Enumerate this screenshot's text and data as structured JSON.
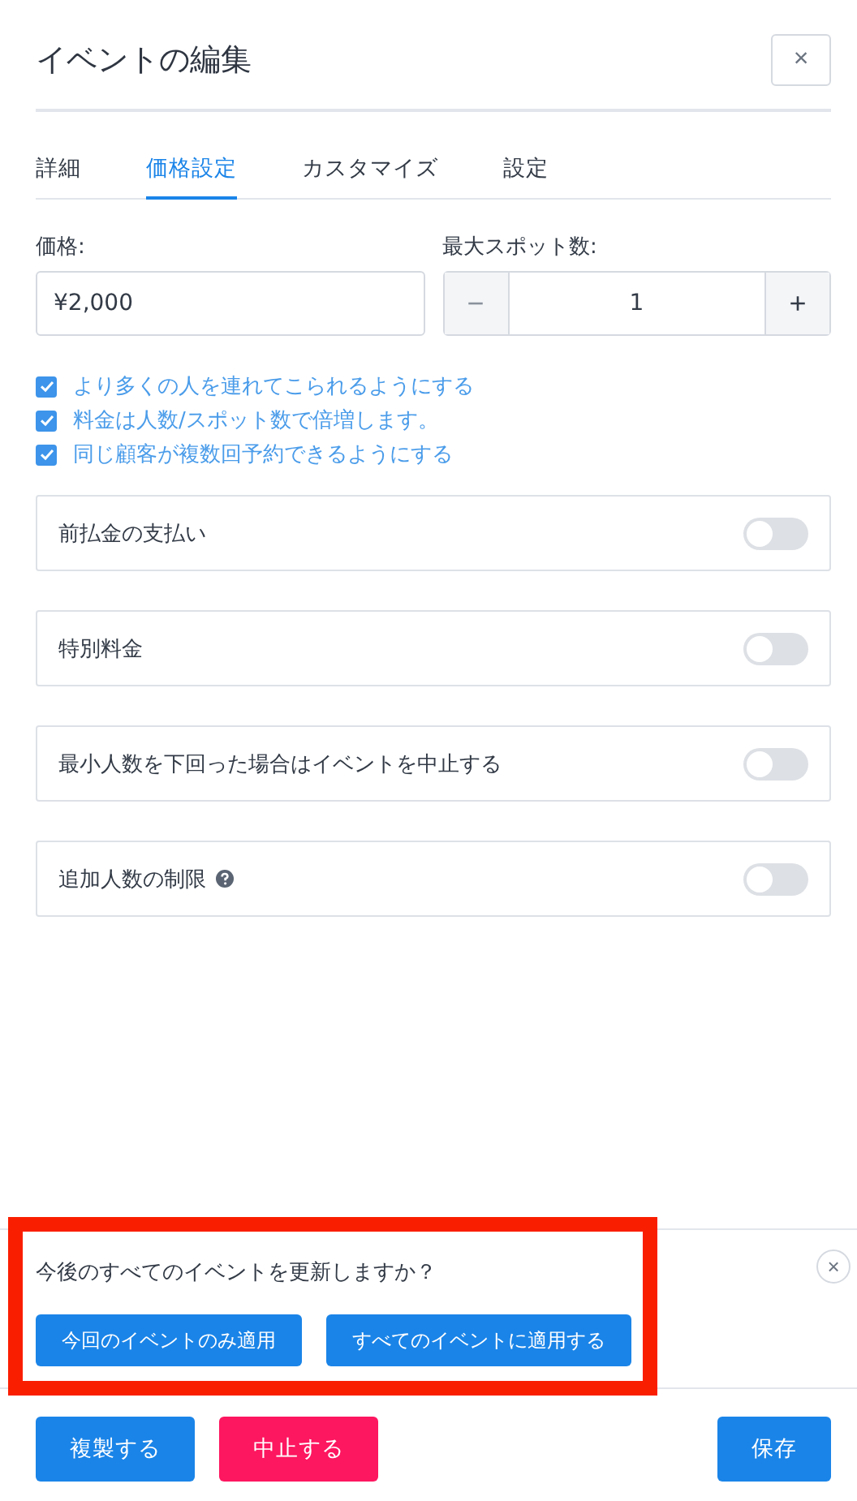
{
  "title": "イベントの編集",
  "close": "×",
  "tabs": [
    {
      "label": "詳細",
      "selected": false
    },
    {
      "label": "価格設定",
      "selected": true
    },
    {
      "label": "カスタマイズ",
      "selected": false
    },
    {
      "label": "設定",
      "selected": false
    }
  ],
  "price": {
    "label": "価格:",
    "value": "¥2,000"
  },
  "spots": {
    "label": "最大スポット数:",
    "minus": "−",
    "value": "1",
    "plus": "+",
    "minus_disabled": true
  },
  "checkboxes": [
    {
      "label": "より多くの人を連れてこられるようにする",
      "checked": true
    },
    {
      "label": "料金は人数/スポット数で倍増します。",
      "checked": true
    },
    {
      "label": "同じ顧客が複数回予約できるようにする",
      "checked": true
    }
  ],
  "toggles": [
    {
      "label": "前払金の支払い",
      "on": false,
      "help": false
    },
    {
      "label": "特別料金",
      "on": false,
      "help": false
    },
    {
      "label": "最小人数を下回った場合はイベントを中止する",
      "on": false,
      "help": false
    },
    {
      "label": "追加人数の制限",
      "on": false,
      "help": true
    }
  ],
  "banner": {
    "question": "今後のすべてのイベントを更新しますか？",
    "buttons": [
      "今回のイベントのみ適用",
      "すべてのイベントに適用する"
    ],
    "close": "×",
    "highlighted": true
  },
  "footer": [
    {
      "label": "複製する",
      "kind": "primary"
    },
    {
      "label": "中止する",
      "kind": "danger"
    },
    {
      "label": "保存",
      "kind": "primary"
    }
  ]
}
